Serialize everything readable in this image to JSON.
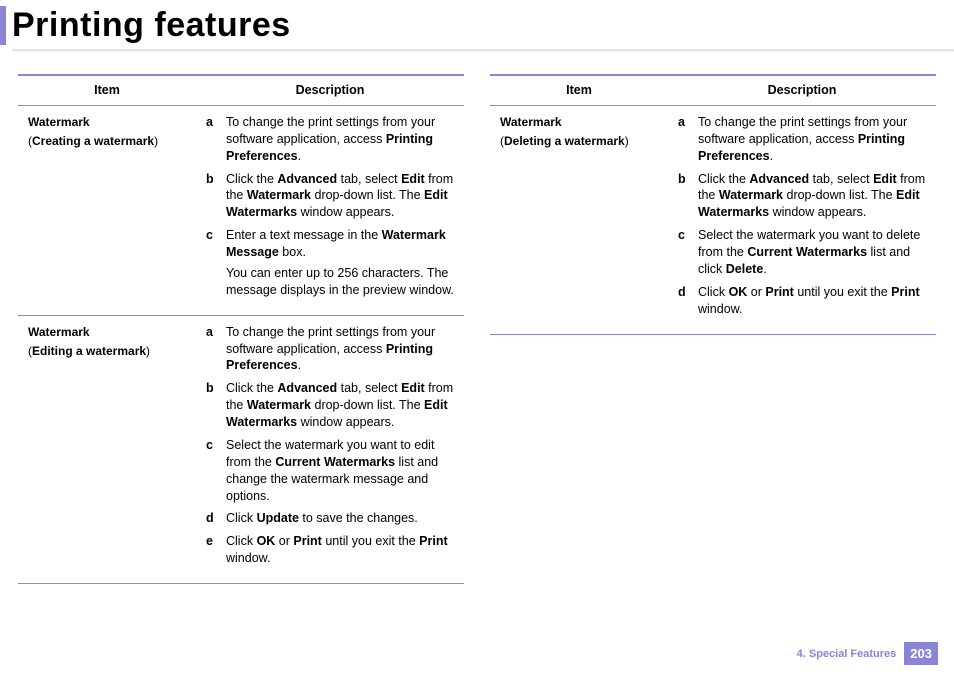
{
  "title": "Printing features",
  "headers": {
    "item": "Item",
    "description": "Description"
  },
  "left": [
    {
      "item_main": "Watermark",
      "item_sub": "Creating a watermark",
      "steps": [
        {
          "m": "a",
          "html": "To change the print settings from your software application, access <b>Printing Preferences</b>."
        },
        {
          "m": "b",
          "html": "Click the <b>Advanced</b> tab, select <b>Edit</b> from the <b>Watermark</b> drop-down list. The <b>Edit Watermarks</b> window appears."
        },
        {
          "m": "c",
          "html": "Enter a text message in the <b>Watermark Message</b> box.",
          "extra": "You can enter up to 256 characters. The message displays in the preview window."
        }
      ]
    },
    {
      "item_main": "Watermark",
      "item_sub": "Editing a watermark",
      "steps": [
        {
          "m": "a",
          "html": "To change the print settings from your software application, access <b>Printing Preferences</b>."
        },
        {
          "m": "b",
          "html": "Click the <b>Advanced</b> tab, select <b>Edit</b> from the <b>Watermark</b> drop-down list. The <b>Edit Watermarks</b> window appears."
        },
        {
          "m": "c",
          "html": "Select the watermark you want to edit from the <b>Current Watermarks</b> list and change the watermark message and options."
        },
        {
          "m": "d",
          "html": "Click <b>Update</b> to save the changes."
        },
        {
          "m": "e",
          "html": "Click <b>OK</b> or <b>Print</b> until you exit the <b>Print</b> window."
        }
      ]
    }
  ],
  "right": [
    {
      "item_main": "Watermark",
      "item_sub": "Deleting a watermark",
      "steps": [
        {
          "m": "a",
          "html": "To change the print settings from your software application, access <b>Printing Preferences</b>."
        },
        {
          "m": "b",
          "html": "Click the <b>Advanced</b> tab, select <b>Edit</b> from the <b>Watermark</b> drop-down list. The <b>Edit Watermarks</b> window appears."
        },
        {
          "m": "c",
          "html": "Select the watermark you want to delete from the <b>Current Watermarks</b> list and click <b>Delete</b>."
        },
        {
          "m": "d",
          "html": "Click <b>OK</b> or <b>Print</b> until you exit the <b>Print</b> window."
        }
      ]
    }
  ],
  "footer": {
    "chapter": "4.  Special Features",
    "page": "203"
  }
}
